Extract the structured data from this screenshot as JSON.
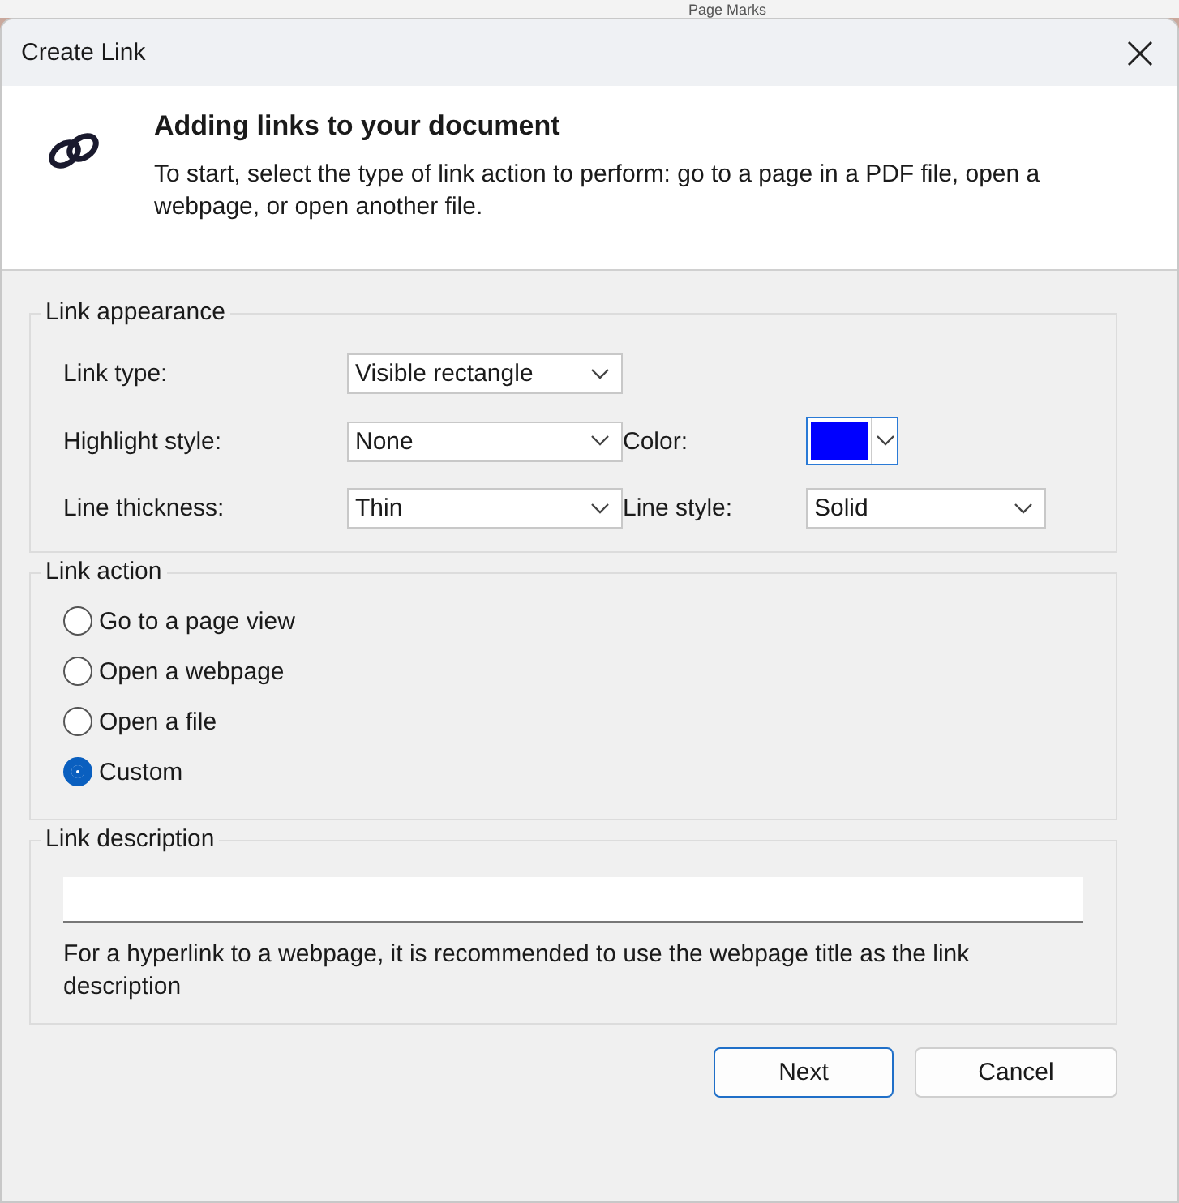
{
  "background_app": {
    "heading": "Page Marks"
  },
  "window": {
    "title": "Create Link"
  },
  "header": {
    "title": "Adding links to your document",
    "description": "To start, select the type of link action to perform: go to a page in a PDF file, open a webpage, or open another file."
  },
  "link_appearance": {
    "legend": "Link appearance",
    "link_type": {
      "label": "Link type:",
      "value": "Visible rectangle"
    },
    "highlight_style": {
      "label": "Highlight style:",
      "value": "None"
    },
    "color": {
      "label": "Color:",
      "color": "#0000ff"
    },
    "line_thickness": {
      "label": "Line thickness:",
      "value": "Thin"
    },
    "line_style": {
      "label": "Line style:",
      "value": "Solid"
    }
  },
  "link_action": {
    "legend": "Link action",
    "options": [
      {
        "label": "Go to a page view",
        "selected": false
      },
      {
        "label": "Open a webpage",
        "selected": false
      },
      {
        "label": "Open a file",
        "selected": false
      },
      {
        "label": "Custom",
        "selected": true
      }
    ]
  },
  "link_description": {
    "legend": "Link description",
    "hint": "For a hyperlink to a webpage, it is recommended to use the webpage title as the link description"
  },
  "buttons": [
    {
      "label": "Next",
      "kind": "default"
    },
    {
      "label": "Cancel",
      "kind": "normal"
    }
  ]
}
